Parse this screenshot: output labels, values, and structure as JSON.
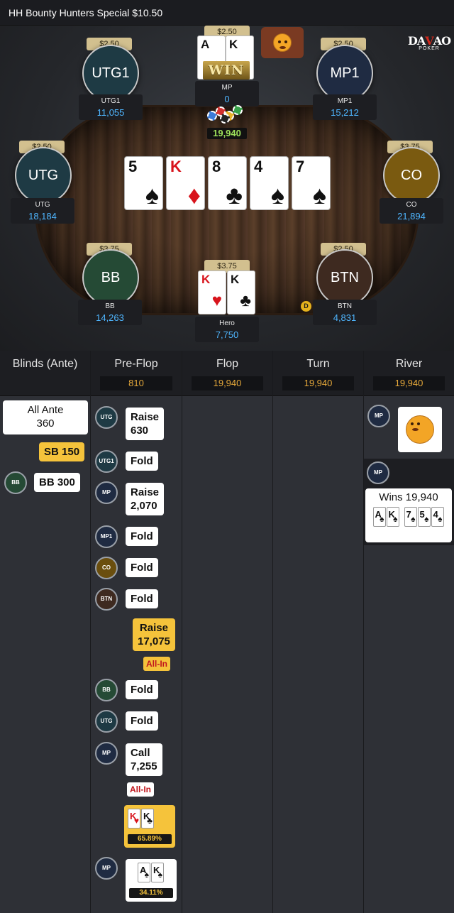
{
  "header": {
    "title": "HH  Bounty Hunters Special $10.50"
  },
  "logo": {
    "text_a": "DA",
    "text_b": "V",
    "text_c": "AO",
    "sub": "POKER"
  },
  "table": {
    "win_label": "WIN",
    "pot": "19,940",
    "dealer_label": "D",
    "board": [
      {
        "rank": "5",
        "suit": "♠",
        "color": "black"
      },
      {
        "rank": "K",
        "suit": "♦",
        "color": "red"
      },
      {
        "rank": "8",
        "suit": "♣",
        "color": "black"
      },
      {
        "rank": "4",
        "suit": "♠",
        "color": "black"
      },
      {
        "rank": "7",
        "suit": "♠",
        "color": "black"
      }
    ],
    "seats": {
      "utg1": {
        "avatar": "UTG1",
        "name": "UTG1",
        "stack": "11,055",
        "bet": "$2.50",
        "color": "#1e3a44"
      },
      "mp": {
        "name": "MP",
        "stack": "0",
        "bet": "$2.50",
        "cards": [
          {
            "rank": "A",
            "suit": "♠"
          },
          {
            "rank": "K",
            "suit": "♠"
          }
        ]
      },
      "mp1": {
        "avatar": "MP1",
        "name": "MP1",
        "stack": "15,212",
        "bet": "$2.50",
        "color": "#1f2b42"
      },
      "utg": {
        "avatar": "UTG",
        "name": "UTG",
        "stack": "18,184",
        "bet": "$2.50",
        "color": "#1e3a44"
      },
      "co": {
        "avatar": "CO",
        "name": "CO",
        "stack": "21,894",
        "bet": "$3.75",
        "color": "#7a5a10"
      },
      "bb": {
        "avatar": "BB",
        "name": "BB",
        "stack": "14,263",
        "bet": "$3.75",
        "color": "#254a35"
      },
      "hero": {
        "name": "Hero",
        "stack": "7,750",
        "bet": "$3.75",
        "cards": [
          {
            "rank": "K",
            "suit": "♥"
          },
          {
            "rank": "K",
            "suit": "♣"
          }
        ]
      },
      "btn": {
        "avatar": "BTN",
        "name": "BTN",
        "stack": "4,831",
        "bet": "$2.50",
        "color": "#3e2a20"
      }
    }
  },
  "history": {
    "columns": [
      {
        "title": "Blinds (Ante)",
        "pot": ""
      },
      {
        "title": "Pre-Flop",
        "pot": "810"
      },
      {
        "title": "Flop",
        "pot": "19,940"
      },
      {
        "title": "Turn",
        "pot": "19,940"
      },
      {
        "title": "River",
        "pot": "19,940"
      }
    ],
    "blinds": {
      "ante_line1": "All Ante",
      "ante_line2": "360",
      "sb": "SB  150",
      "bb_avatar": "BB",
      "bb": "BB  300"
    },
    "preflop": [
      {
        "avatar": "UTG",
        "line1": "Raise",
        "line2": "630"
      },
      {
        "avatar": "UTG1",
        "line1": "Fold"
      },
      {
        "avatar": "MP",
        "line1": "Raise",
        "line2": "2,070"
      },
      {
        "avatar": "MP1",
        "line1": "Fold"
      },
      {
        "avatar": "CO",
        "line1": "Fold"
      },
      {
        "avatar": "BTN",
        "line1": "Fold"
      }
    ],
    "hero_raise": {
      "line1": "Raise",
      "line2": "17,075",
      "allin": "All-In"
    },
    "preflop_after": [
      {
        "avatar": "BB",
        "line1": "Fold"
      },
      {
        "avatar": "UTG",
        "line1": "Fold"
      }
    ],
    "mp_call": {
      "avatar": "MP",
      "line1": "Call",
      "line2": "7,255",
      "allin": "All-In"
    },
    "hero_show": {
      "cards": [
        {
          "rank": "K",
          "suit": "♥"
        },
        {
          "rank": "K",
          "suit": "♣"
        }
      ],
      "equity": "65.89%"
    },
    "mp_show": {
      "avatar": "MP",
      "cards": [
        {
          "rank": "A",
          "suit": "♠"
        },
        {
          "rank": "K",
          "suit": "♠"
        }
      ],
      "equity": "34.11%"
    },
    "river": {
      "emote_avatar": "MP",
      "win_avatar": "MP",
      "win_text": "Wins 19,940",
      "win_cards": [
        {
          "rank": "A",
          "suit": "♠"
        },
        {
          "rank": "K",
          "suit": "♠"
        },
        {
          "rank": "7",
          "suit": "♠"
        },
        {
          "rank": "5",
          "suit": "♠"
        },
        {
          "rank": "4",
          "suit": "♠"
        }
      ]
    }
  },
  "colors": {
    "accent": "#f5c33b",
    "stack_blue": "#4fb6ff",
    "pot_green": "#9fe25c",
    "col_pot": "#e5a83a"
  }
}
